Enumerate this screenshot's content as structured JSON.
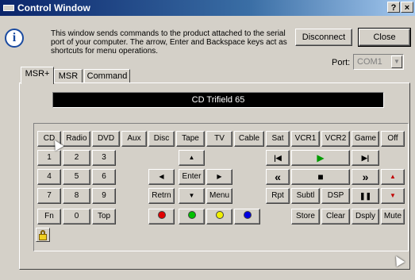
{
  "window": {
    "title": "Control Window",
    "help_label": "?",
    "close_label": "×"
  },
  "info": {
    "icon": "info-icon",
    "glyph": "i",
    "text": "This window sends commands to the product attached to the serial port of your computer. The arrow, Enter and Backspace keys act as shortcuts for menu operations."
  },
  "buttons": {
    "disconnect": "Disconnect",
    "close": "Close"
  },
  "port": {
    "label": "Port:",
    "value": "COM1"
  },
  "tabs": [
    "MSR+",
    "MSR",
    "Command"
  ],
  "display": {
    "text": "CD   Trifield   65"
  },
  "keys": {
    "row1": [
      "CD",
      "Radio",
      "DVD",
      "Aux",
      "Disc",
      "Tape",
      "TV",
      "Cable",
      "Sat",
      "VCR1",
      "VCR2",
      "Game",
      "Off"
    ],
    "num": [
      "1",
      "2",
      "3",
      "4",
      "5",
      "6",
      "7",
      "8",
      "9",
      "Fn",
      "0",
      "Top"
    ],
    "nav": {
      "enter": "Enter",
      "retrn": "Retrn",
      "menu": "Menu"
    },
    "transport_labels": {
      "rpt": "Rpt",
      "subtl": "Subtl",
      "dsp": "DSP",
      "store": "Store",
      "clear": "Clear",
      "dsply": "Dsply",
      "mute": "Mute"
    }
  },
  "glyphs": {
    "up": "▲",
    "down": "▼",
    "left": "◀",
    "right": "▶",
    "prev": "|◀",
    "play": "▶",
    "next": "▶|",
    "rew": "«",
    "stop": "■",
    "ffw": "»",
    "pause": "❚❚"
  },
  "colors": {
    "play": "#009a00",
    "vol_up": "#c00000",
    "vol_down": "#c00000",
    "red": "#e00000",
    "green": "#00c000",
    "yellow": "#f0f000",
    "blue": "#0000e0"
  }
}
